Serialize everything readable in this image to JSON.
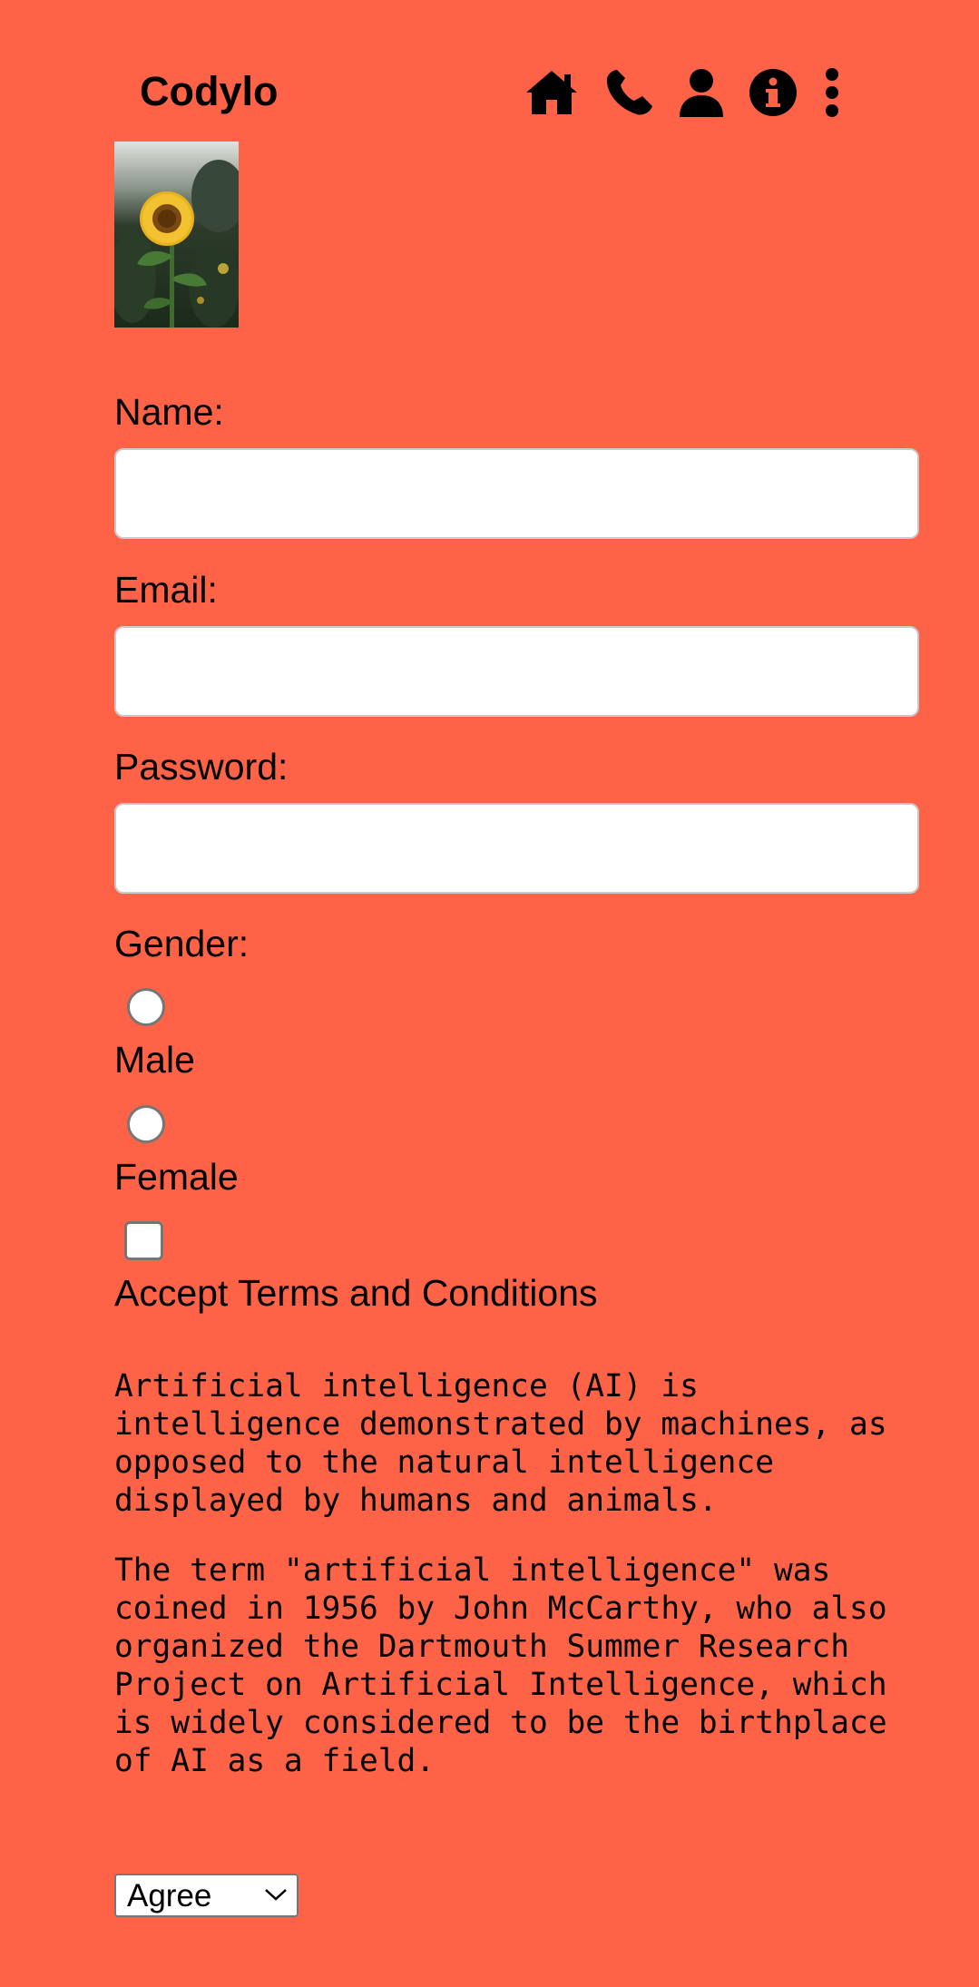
{
  "header": {
    "brand": "Codylo",
    "nav": [
      {
        "icon": "home-icon"
      },
      {
        "icon": "phone-icon"
      },
      {
        "icon": "user-icon"
      },
      {
        "icon": "info-icon"
      },
      {
        "icon": "more-vertical-icon"
      }
    ]
  },
  "form": {
    "name_label": "Name:",
    "name_value": "",
    "email_label": "Email:",
    "email_value": "",
    "password_label": "Password:",
    "password_value": "",
    "gender_label": "Gender:",
    "gender_options": [
      {
        "label": "Male",
        "checked": false
      },
      {
        "label": "Female",
        "checked": false
      }
    ],
    "terms_label": "Accept Terms and Conditions",
    "terms_checked": false
  },
  "content": {
    "paragraphs": [
      "Artificial intelligence (AI) is intelligence demonstrated by machines, as opposed to the natural intelligence displayed by humans and animals.",
      "The term \"artificial intelligence\" was coined in 1956 by John McCarthy, who also organized the Dartmouth Summer Research Project on Artificial Intelligence, which is widely considered to be the birthplace of AI as a field."
    ]
  },
  "select": {
    "value": "Agree"
  },
  "colors": {
    "background": "#ff6347",
    "input_background": "#ffffff",
    "text": "#000000"
  }
}
